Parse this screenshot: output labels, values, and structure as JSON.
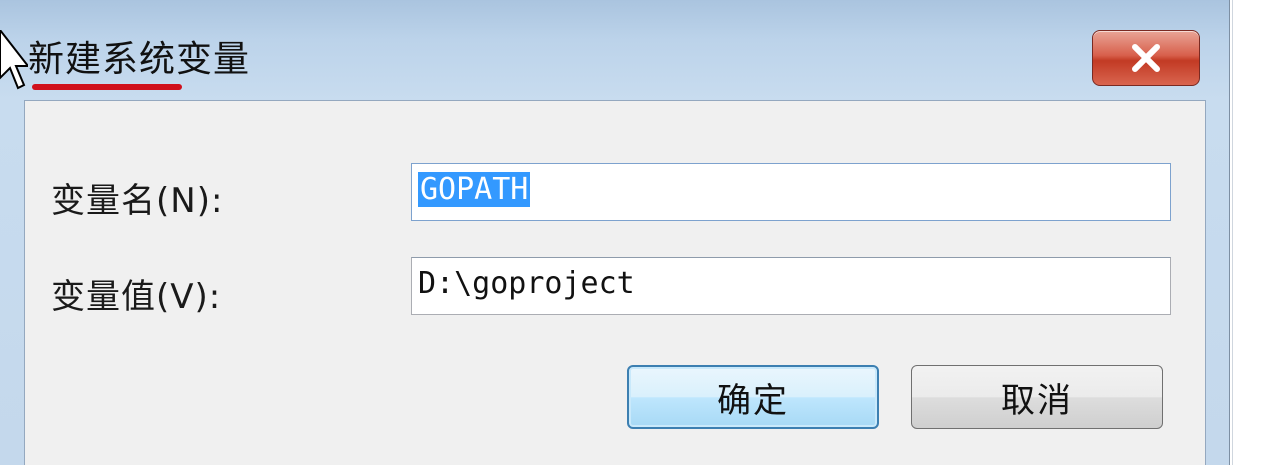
{
  "dialog": {
    "title": "新建系统变量",
    "close_icon": "close-icon",
    "accent_underline_color": "#d0101c"
  },
  "form": {
    "name_label": "变量名(N):",
    "name_value": "GOPATH",
    "value_label": "变量值(V):",
    "value_value": "D:\\goproject"
  },
  "buttons": {
    "ok_label": "确定",
    "cancel_label": "取消"
  }
}
